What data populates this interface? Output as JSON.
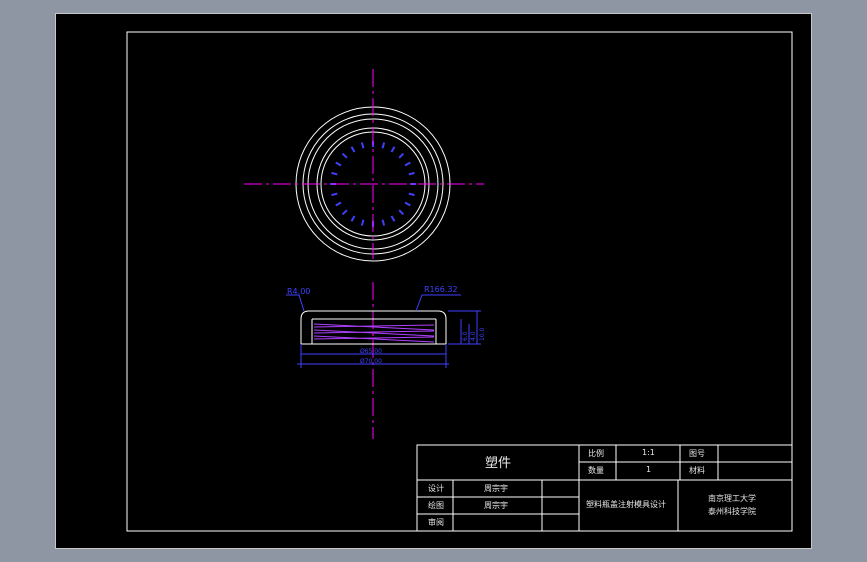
{
  "drawing": {
    "dimensions": {
      "r_small": "R4.00",
      "r_large": "R166.32",
      "width_inner": "Ø65.00",
      "width_outer": "Ø70.00",
      "h1": "10.0",
      "h2": "6.0",
      "h3": "4.0"
    }
  },
  "title_block": {
    "part_name": "塑件",
    "scale_label": "比例",
    "scale_value": "1:1",
    "drawing_no_label": "图号",
    "qty_label": "数量",
    "qty_value": "1",
    "material_label": "材料",
    "design_label": "设计",
    "design_name": "周宗宇",
    "draw_label": "绘图",
    "draw_name": "周宗宇",
    "review_label": "审阅",
    "project_title": "塑料瓶盖注射模具设计",
    "school_line1": "南京理工大学",
    "school_line2": "泰州科技学院"
  },
  "colors": {
    "line": "#ffffff",
    "center_line": "#ff00ff",
    "dimension": "#4040ff",
    "hatch": "#b040ff"
  }
}
